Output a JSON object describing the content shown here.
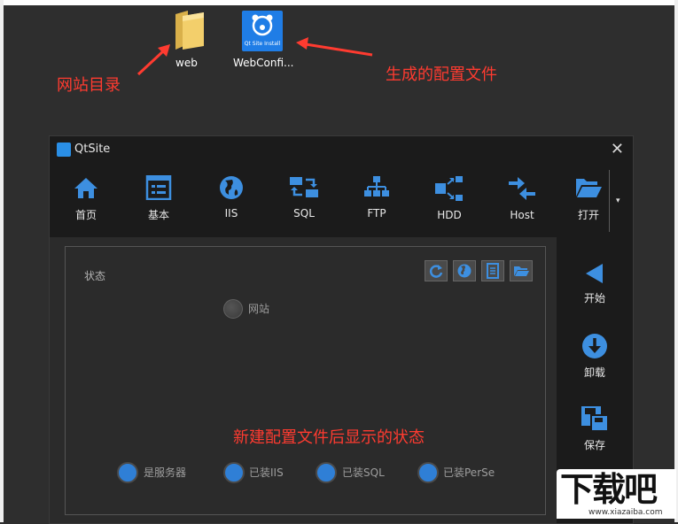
{
  "desktop": {
    "folder_label": "web",
    "config_label": "WebConfi...",
    "config_icon_text": "Qt Site Install"
  },
  "annotations": {
    "folder_note": "网站目录",
    "config_note": "生成的配置文件",
    "status_note": "新建配置文件后显示的状态"
  },
  "window": {
    "title": "QtSite",
    "close": "✕"
  },
  "toolbar": {
    "items": [
      {
        "label": "首页",
        "icon": "home-icon"
      },
      {
        "label": "基本",
        "icon": "settings-form-icon"
      },
      {
        "label": "IIS",
        "icon": "globe-icon"
      },
      {
        "label": "SQL",
        "icon": "database-sync-icon"
      },
      {
        "label": "FTP",
        "icon": "sitemap-icon"
      },
      {
        "label": "HDD",
        "icon": "hdd-expand-icon"
      },
      {
        "label": "Host",
        "icon": "swap-arrows-icon"
      },
      {
        "label": "打开",
        "icon": "folder-open-icon"
      }
    ],
    "more": "▾"
  },
  "panel": {
    "title": "状态",
    "buttons": [
      "refresh-icon",
      "globe-icon",
      "document-icon",
      "folder-icon"
    ],
    "website_label": "网站",
    "checks": [
      {
        "label": "是服务器",
        "state": "on"
      },
      {
        "label": "已装IIS",
        "state": "on"
      },
      {
        "label": "已装SQL",
        "state": "on"
      },
      {
        "label": "已装PerSe",
        "state": "on"
      }
    ]
  },
  "sidebar": {
    "items": [
      {
        "label": "开始",
        "icon": "play-left-icon"
      },
      {
        "label": "卸载",
        "icon": "download-circle-icon"
      },
      {
        "label": "保存",
        "icon": "save-icon"
      }
    ]
  },
  "watermark": {
    "text": "下载吧",
    "url": "www.xiazaiba.com"
  },
  "colors": {
    "accent": "#3d8fe0",
    "annotation": "#ff3b30",
    "window_bg": "#1b1b1b",
    "content_bg": "#2b2b2b"
  }
}
